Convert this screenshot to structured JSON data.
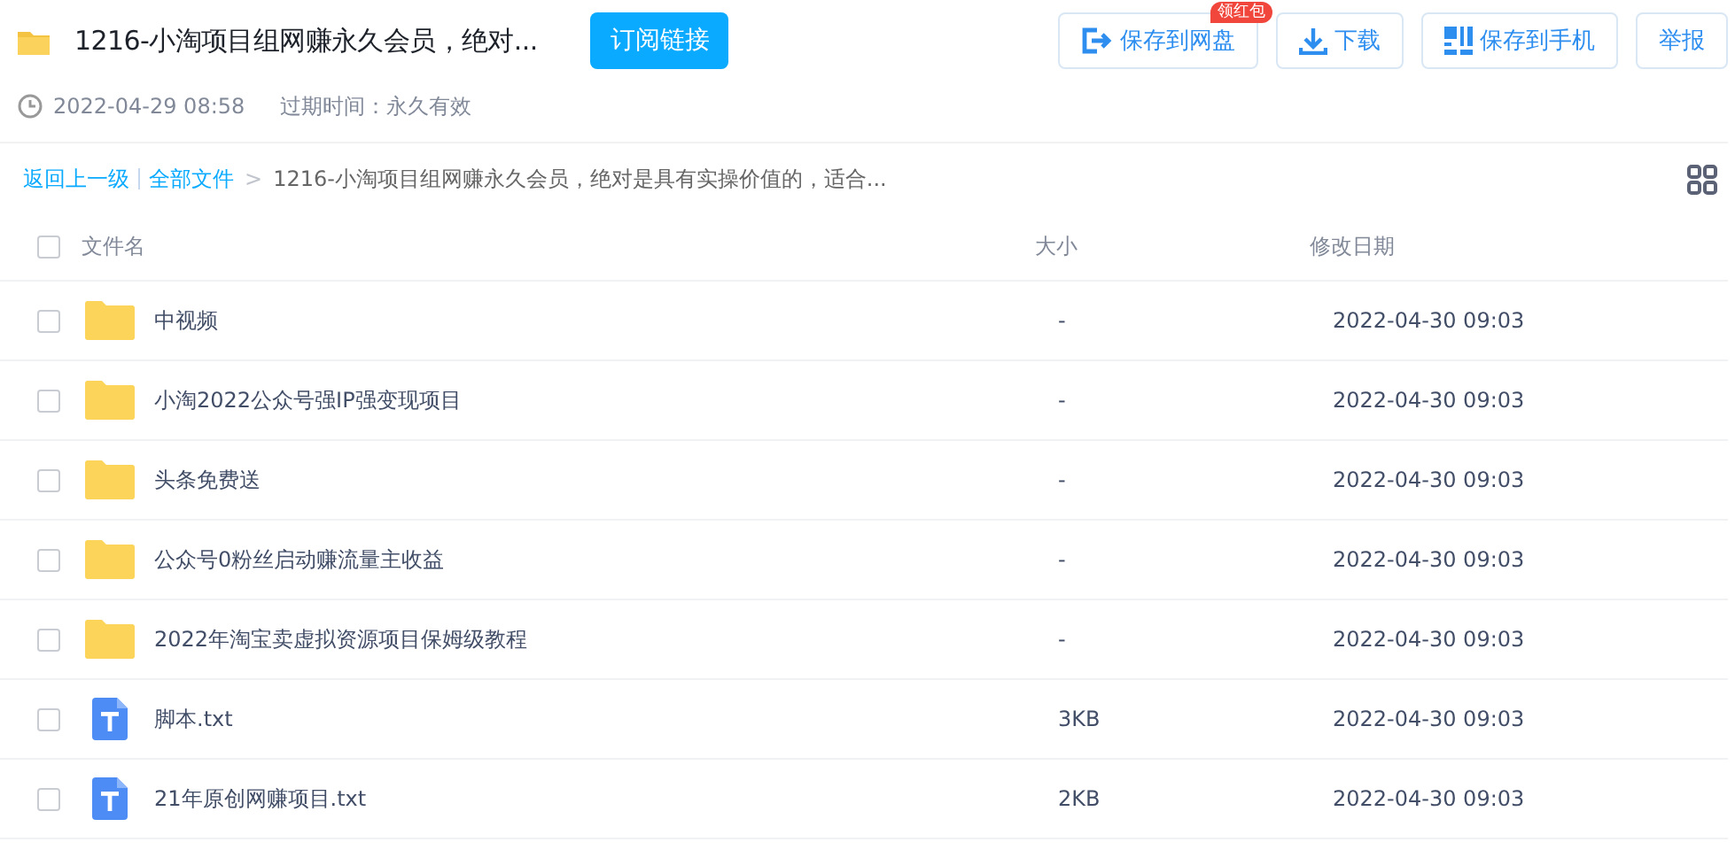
{
  "header": {
    "title": "1216-小淘项目组网赚永久会员，绝对...",
    "subscribe_button": "订阅链接",
    "actions": [
      {
        "kind": "save",
        "label": "保存到网盘",
        "badge": "领红包"
      },
      {
        "kind": "download",
        "label": "下载"
      },
      {
        "kind": "phone",
        "label": "保存到手机"
      },
      {
        "kind": "report",
        "label": "举报"
      }
    ]
  },
  "meta": {
    "created": "2022-04-29 08:58",
    "expiry": "过期时间：永久有效"
  },
  "breadcrumb": {
    "back": "返回上一级",
    "root": "全部文件",
    "separator": ">",
    "current": "1216-小淘项目组网赚永久会员，绝对是具有实操价值的，适合..."
  },
  "table": {
    "columns": [
      "文件名",
      "大小",
      "修改日期"
    ],
    "all_checked": false,
    "rows": [
      {
        "kind": "folder",
        "name": "中视频",
        "size": "-",
        "date": "2022-04-30 09:03",
        "checked": false
      },
      {
        "kind": "folder",
        "name": "小淘2022公众号强IP强变现项目",
        "size": "-",
        "date": "2022-04-30 09:03",
        "checked": false
      },
      {
        "kind": "folder",
        "name": "头条免费送",
        "size": "-",
        "date": "2022-04-30 09:03",
        "checked": false
      },
      {
        "kind": "folder",
        "name": "公众号0粉丝启动赚流量主收益",
        "size": "-",
        "date": "2022-04-30 09:03",
        "checked": false
      },
      {
        "kind": "folder",
        "name": "2022年淘宝卖虚拟资源项目保姆级教程",
        "size": "-",
        "date": "2022-04-30 09:03",
        "checked": false
      },
      {
        "kind": "text",
        "name": "脚本.txt",
        "size": "3KB",
        "date": "2022-04-30 09:03",
        "checked": false
      },
      {
        "kind": "text",
        "name": "21年原创网赚项目.txt",
        "size": "2KB",
        "date": "2022-04-30 09:03",
        "checked": false
      }
    ]
  }
}
